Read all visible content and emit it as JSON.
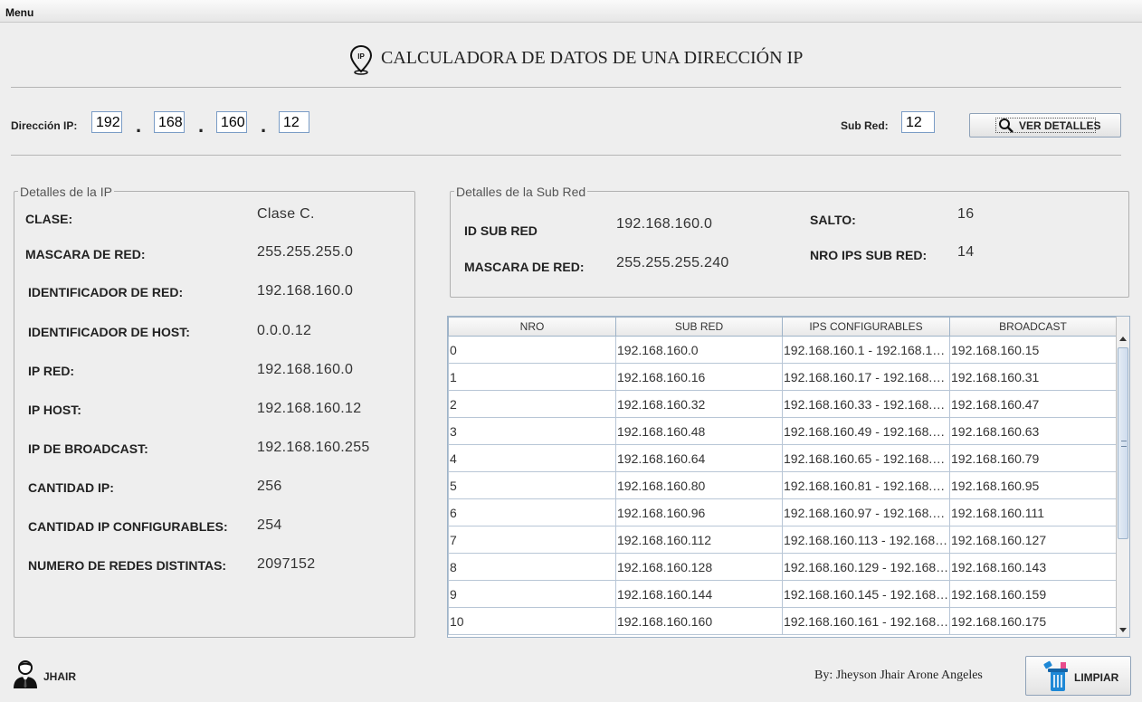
{
  "menubar": {
    "menu_label": "Menu"
  },
  "header": {
    "title": "CALCULADORA DE DATOS DE UNA DIRECCIÓN IP",
    "icon": "location-pin-ip-icon",
    "icon_text": "IP"
  },
  "input_row": {
    "ip_label": "Dirección IP:",
    "octets": [
      "192",
      "168",
      "160",
      "12"
    ],
    "subnet_label": "Sub Red:",
    "subnet_value": "12",
    "details_button": "VER DETALLES"
  },
  "ip_details": {
    "title": "Detalles de la IP",
    "rows": [
      {
        "label": "CLASE:",
        "value": "Clase C."
      },
      {
        "label": "MASCARA DE RED:",
        "value": "255.255.255.0"
      },
      {
        "label": "IDENTIFICADOR DE RED:",
        "value": "192.168.160.0"
      },
      {
        "label": "IDENTIFICADOR DE HOST:",
        "value": "0.0.0.12"
      },
      {
        "label": "IP RED:",
        "value": "192.168.160.0"
      },
      {
        "label": "IP HOST:",
        "value": "192.168.160.12"
      },
      {
        "label": "IP DE BROADCAST:",
        "value": "192.168.160.255"
      },
      {
        "label": "CANTIDAD IP:",
        "value": "256"
      },
      {
        "label": "CANTIDAD IP CONFIGURABLES:",
        "value": "254"
      },
      {
        "label": "NUMERO DE REDES DISTINTAS:",
        "value": "2097152"
      }
    ]
  },
  "subnet_details": {
    "title": "Detalles de la Sub Red",
    "id_label": "ID SUB RED",
    "id_value": "192.168.160.0",
    "mask_label": "MASCARA DE RED:",
    "mask_value": "255.255.255.240",
    "jump_label": "SALTO:",
    "jump_value": "16",
    "ips_label": "NRO IPS SUB RED:",
    "ips_value": "14"
  },
  "table": {
    "headers": [
      "NRO",
      "SUB RED",
      "IPS CONFIGURABLES",
      "BROADCAST"
    ],
    "rows": [
      [
        "0",
        "192.168.160.0",
        "192.168.160.1 - 192.168.16...",
        "192.168.160.15"
      ],
      [
        "1",
        "192.168.160.16",
        "192.168.160.17 - 192.168.1...",
        "192.168.160.31"
      ],
      [
        "2",
        "192.168.160.32",
        "192.168.160.33 - 192.168.1...",
        "192.168.160.47"
      ],
      [
        "3",
        "192.168.160.48",
        "192.168.160.49 - 192.168.1...",
        "192.168.160.63"
      ],
      [
        "4",
        "192.168.160.64",
        "192.168.160.65 - 192.168.1...",
        "192.168.160.79"
      ],
      [
        "5",
        "192.168.160.80",
        "192.168.160.81 - 192.168.1...",
        "192.168.160.95"
      ],
      [
        "6",
        "192.168.160.96",
        "192.168.160.97 - 192.168.1...",
        "192.168.160.111"
      ],
      [
        "7",
        "192.168.160.112",
        "192.168.160.113 - 192.168.1...",
        "192.168.160.127"
      ],
      [
        "8",
        "192.168.160.128",
        "192.168.160.129 - 192.168....",
        "192.168.160.143"
      ],
      [
        "9",
        "192.168.160.144",
        "192.168.160.145 - 192.168....",
        "192.168.160.159"
      ],
      [
        "10",
        "192.168.160.160",
        "192.168.160.161 - 192.168.1...",
        "192.168.160.175"
      ]
    ]
  },
  "footer": {
    "user_label": "JHAIR",
    "user_icon": "person-avatar-icon",
    "author": "By: Jheyson Jhair Arone Angeles",
    "clear_button": "LIMPIAR",
    "clear_icon": "trash-bin-icon"
  },
  "colors": {
    "field_border": "#7a9cc6",
    "scroll_thumb": "#cfdced",
    "trash_blue": "#1e88d6"
  }
}
